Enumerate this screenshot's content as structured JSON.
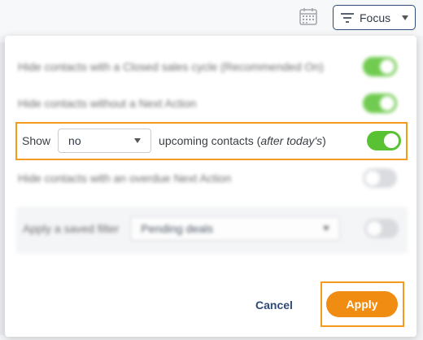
{
  "header": {
    "calendar_icon": "calendar-icon",
    "filter_icon": "filter-lines-icon",
    "focus_label": "Focus"
  },
  "filters": {
    "hide_closed": {
      "label": "Hide contacts with a Closed sales cycle (Recommended On)",
      "toggle_on": true
    },
    "hide_no_next_action": {
      "label": "Hide contacts without a Next Action",
      "toggle_on": true
    },
    "upcoming": {
      "show_label": "Show",
      "select_value": "no",
      "after_label": "upcoming contacts (",
      "after_italic": "after today's",
      "after_close": ")",
      "toggle_on": true
    },
    "hide_overdue": {
      "label": "Hide contacts with an overdue Next Action",
      "toggle_on": false
    },
    "saved_filter": {
      "label": "Apply a saved filter",
      "select_value": "Pending deals",
      "toggle_on": false
    }
  },
  "footer": {
    "cancel_label": "Cancel",
    "apply_label": "Apply"
  },
  "colors": {
    "toggle_on": "#58c232",
    "toggle_off": "#d4d6da",
    "highlight": "#f39a1f",
    "apply_bg": "#f08c12",
    "link": "#2f4a7a"
  }
}
